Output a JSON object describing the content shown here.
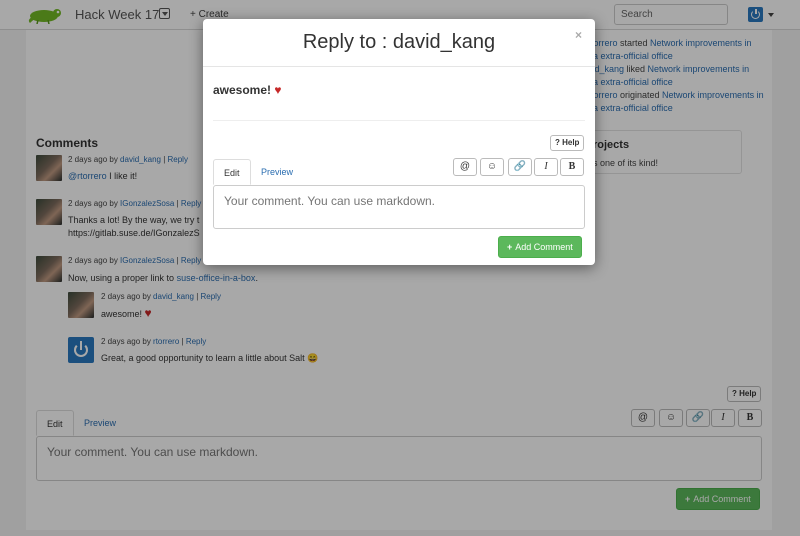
{
  "navbar": {
    "brand": "Hack Week 17",
    "create": "+ Create",
    "search_placeholder": "Search"
  },
  "activity": [
    {
      "actor": "rtorrero",
      "verb": "started",
      "target": "Network improvements in"
    },
    {
      "actor": "",
      "verb": "",
      "target": "suse-office-in-a-box / Korea extra-official office"
    },
    {
      "actor": "david_kang",
      "verb": "liked",
      "target": "Network improvements in"
    },
    {
      "actor": "",
      "verb": "",
      "target": "suse-office-in-a-box / Korea extra-official office"
    },
    {
      "actor": "rtorrero",
      "verb": "originated",
      "target": "Network improvements in"
    },
    {
      "actor": "",
      "verb": "",
      "target": "suse-office-in-a-box / Korea extra-official office"
    }
  ],
  "activity_display": {
    "l1_a": "rtorrero",
    "l1_b": " started ",
    "l1_c": "Network improvements in",
    "l2": "ria extra-official office",
    "l3_a": "vid_kang",
    "l3_b": " liked ",
    "l3_c": "Network improvements in",
    "l4": "ria extra-official office",
    "l5_a": "rtorrero",
    "l5_b": " originated ",
    "l5_c": "Network improvements in",
    "l6": "ria extra-official office"
  },
  "projects": {
    "title": "rojects",
    "body": "s one of its kind!"
  },
  "comments": {
    "title": "Comments",
    "items": [
      {
        "time": "2 days ago by ",
        "user": "david_kang",
        "sep": " | ",
        "reply": "Reply",
        "mention": "@rtorrero",
        "text": " I like it!"
      },
      {
        "time": "2 days ago by ",
        "user": "IGonzalezSosa",
        "sep": " | ",
        "reply": "Reply",
        "text": "Thanks a lot! By the way, we try t",
        "text2": "https://gitlab.suse.de/IGonzalezS"
      },
      {
        "time": "2 days ago by ",
        "user": "IGonzalezSosa",
        "sep": " | ",
        "reply": "Reply",
        "text": "Now, using a proper link to ",
        "link": "suse-office-in-a-box",
        "tail": "."
      },
      {
        "time": "2 days ago by ",
        "user": "david_kang",
        "sep": " | ",
        "reply": "Reply",
        "text": "awesome! ",
        "emoji": "♥"
      },
      {
        "time": "2 days ago by ",
        "user": "rtorrero",
        "sep": " | ",
        "reply": "Reply",
        "text": "Great, a good opportunity to learn a little about Salt ",
        "emoji": "😄"
      }
    ]
  },
  "editor": {
    "help": "? Help",
    "tab_edit": "Edit",
    "tab_preview": "Preview",
    "tool_mention": "@",
    "tool_emoji": "☺",
    "tool_link": "🔗",
    "tool_italic": "I",
    "tool_bold": "B",
    "placeholder": "Your comment. You can use markdown.",
    "add_button": "Add Comment",
    "add_plus": "+"
  },
  "modal": {
    "title": "Reply to : david_kang",
    "close": "×",
    "quote": "awesome! ",
    "quote_emoji": "♥"
  },
  "colors": {
    "accent_green": "#5cb85c",
    "link_blue": "#2a6db0",
    "brand_blue": "#2a79c0"
  }
}
